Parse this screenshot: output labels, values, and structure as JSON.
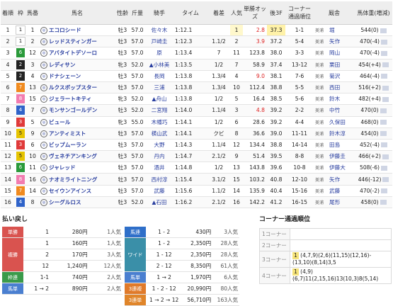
{
  "headers": [
    "着順",
    "枠",
    "馬番",
    "馬名",
    "性齢",
    "斤量",
    "騎手",
    "タイム",
    "着差",
    "人気",
    "単勝オッズ",
    "後3F",
    "コーナー通過順位",
    "厩舎",
    "馬体重(増減)"
  ],
  "rows": [
    {
      "rank": "1",
      "waku": "1",
      "num": "1",
      "name": "エコロシード",
      "sex": "牡3",
      "weight": "57.0",
      "jockey": "佐々木",
      "time": "1:12.1",
      "margin": "",
      "pop": "1",
      "odds": "2.8",
      "last3f": "37.3",
      "corner": "1-1",
      "area": "美浦",
      "trainer": "堀",
      "body": "544(0)"
    },
    {
      "rank": "2",
      "waku": "1",
      "num": "2",
      "name": "レッドスティンガー",
      "sex": "牡3",
      "weight": "57.0",
      "jockey": "戸崎圭",
      "time": "1:12.3",
      "margin": "1.1/2",
      "pop": "2",
      "odds": "3.9",
      "last3f": "37.2",
      "corner": "5-4",
      "area": "美浦",
      "trainer": "矢作",
      "body": "470(-4)"
    },
    {
      "rank": "3",
      "waku": "6",
      "num": "12",
      "name": "アバタイトデソーロ",
      "sex": "牡3",
      "weight": "57.0",
      "jockey": "原",
      "time": "1:13.4",
      "margin": "7",
      "pop": "11",
      "odds": "123.8",
      "last3f": "38.0",
      "corner": "3-3",
      "area": "美浦",
      "trainer": "岡山",
      "body": "470(-4)"
    },
    {
      "rank": "4",
      "waku": "2",
      "num": "3",
      "name": "レディサン",
      "sex": "牝3",
      "weight": "52.0",
      "jockey": "▲小林美",
      "time": "1:13.5",
      "margin": "1/2",
      "pop": "7",
      "odds": "58.9",
      "last3f": "37.4",
      "corner": "13-12",
      "area": "美浦",
      "trainer": "栗田",
      "body": "454(+4)"
    },
    {
      "rank": "5",
      "waku": "2",
      "num": "4",
      "name": "ドナシェーン",
      "sex": "牡3",
      "weight": "57.0",
      "jockey": "長岡",
      "time": "1:13.8",
      "margin": "1.3/4",
      "pop": "4",
      "odds": "9.0",
      "last3f": "38.1",
      "corner": "7-6",
      "area": "美浦",
      "trainer": "菊沢",
      "body": "464(-4)"
    },
    {
      "rank": "6",
      "waku": "7",
      "num": "13",
      "name": "ルクスボップスター",
      "sex": "牡3",
      "weight": "57.0",
      "jockey": "三浦",
      "time": "1:13.8",
      "margin": "1.3/4",
      "pop": "10",
      "odds": "112.4",
      "last3f": "38.8",
      "corner": "5-5",
      "area": "美浦",
      "trainer": "西田",
      "body": "516(+2)"
    },
    {
      "rank": "7",
      "waku": "8",
      "num": "15",
      "name": "ジェラートキティ",
      "sex": "牝3",
      "weight": "52.0",
      "jockey": "▲舟山",
      "time": "1:13.8",
      "margin": "1/2",
      "pop": "5",
      "odds": "16.4",
      "last3f": "38.5",
      "corner": "5-6",
      "area": "美浦",
      "trainer": "鈴木",
      "body": "482(+4)"
    },
    {
      "rank": "8",
      "waku": "4",
      "num": "7",
      "name": "モンサンゴールデン",
      "sex": "牡3",
      "weight": "52.0",
      "jockey": "二宮翔",
      "time": "1:14.0",
      "margin": "1.1/4",
      "pop": "3",
      "odds": "4.8",
      "last3f": "39.2",
      "corner": "2-2",
      "area": "美浦",
      "trainer": "中竹",
      "body": "470(0)"
    },
    {
      "rank": "9",
      "waku": "3",
      "num": "5",
      "name": "ビュール",
      "sex": "牝3",
      "weight": "55.0",
      "jockey": "木幡巧",
      "time": "1:14.1",
      "margin": "1/2",
      "pop": "6",
      "odds": "28.6",
      "last3f": "39.2",
      "corner": "4-4",
      "area": "美浦",
      "trainer": "久保田",
      "body": "468(0)"
    },
    {
      "rank": "10",
      "waku": "5",
      "num": "9",
      "name": "アンティミスト",
      "sex": "牡3",
      "weight": "57.0",
      "jockey": "横山武",
      "time": "1:14.1",
      "margin": "クビ",
      "pop": "8",
      "odds": "36.6",
      "last3f": "39.0",
      "corner": "11-11",
      "area": "美浦",
      "trainer": "鈴木淳",
      "body": "454(0)"
    },
    {
      "rank": "11",
      "waku": "3",
      "num": "6",
      "name": "ビップムーラン",
      "sex": "牡3",
      "weight": "57.0",
      "jockey": "大野",
      "time": "1:14.3",
      "margin": "1.1/4",
      "pop": "12",
      "odds": "134.4",
      "last3f": "38.8",
      "corner": "14-14",
      "area": "美浦",
      "trainer": "田島",
      "body": "452(-4)"
    },
    {
      "rank": "12",
      "waku": "5",
      "num": "10",
      "name": "ヴェネチアンキング",
      "sex": "牡3",
      "weight": "57.0",
      "jockey": "丹内",
      "time": "1:14.7",
      "margin": "2.1/2",
      "pop": "9",
      "odds": "51.4",
      "last3f": "39.5",
      "corner": "8-8",
      "area": "美浦",
      "trainer": "伊藤圭",
      "body": "466(+2)"
    },
    {
      "rank": "13",
      "waku": "6",
      "num": "11",
      "name": "ジャレッド",
      "sex": "牡3",
      "weight": "57.0",
      "jockey": "酒井",
      "time": "1:14.8",
      "margin": "1/2",
      "pop": "13",
      "odds": "143.8",
      "last3f": "39.6",
      "corner": "10-8",
      "area": "美浦",
      "trainer": "伊藤大",
      "body": "508(-6)"
    },
    {
      "rank": "14",
      "waku": "8",
      "num": "16",
      "name": "ナオミライトニング",
      "sex": "牡3",
      "weight": "57.0",
      "jockey": "西村淳",
      "time": "1:15.4",
      "margin": "3.1/2",
      "pop": "15",
      "odds": "103.2",
      "last3f": "40.8",
      "corner": "12-10",
      "area": "美浦",
      "trainer": "矢作",
      "body": "446(-12)"
    },
    {
      "rank": "15",
      "waku": "7",
      "num": "14",
      "name": "セイウンアインス",
      "sex": "牡3",
      "weight": "57.0",
      "jockey": "武藤",
      "time": "1:15.6",
      "margin": "1.1/2",
      "pop": "14",
      "odds": "135.9",
      "last3f": "40.4",
      "corner": "15-16",
      "area": "美浦",
      "trainer": "武藤",
      "body": "470(-2)"
    },
    {
      "rank": "16",
      "waku": "4",
      "num": "8",
      "name": "シーグルロス",
      "sex": "牡3",
      "weight": "52.0",
      "jockey": "▲石田",
      "time": "1:16.2",
      "margin": "2.1/2",
      "pop": "16",
      "odds": "142.2",
      "last3f": "41.2",
      "corner": "16-15",
      "area": "美浦",
      "trainer": "尾形",
      "body": "458(0)"
    }
  ],
  "payout": {
    "title": "払い戻し",
    "tansho": {
      "label": "単勝",
      "num": "1",
      "amount": "280円",
      "pop": "1人気"
    },
    "fukusho": {
      "label": "複勝",
      "lines": [
        {
          "num": "1",
          "amount": "160円",
          "pop": "1人気"
        },
        {
          "num": "2",
          "amount": "170円",
          "pop": "3人気"
        },
        {
          "num": "12",
          "amount": "1,240円",
          "pop": "12人気"
        }
      ]
    },
    "wakuren": {
      "label": "枠連",
      "num": "1-1",
      "amount": "740円",
      "pop": "2人気"
    },
    "umatan2": {
      "label": "馬単",
      "num": "1 → 2",
      "amount": "890円",
      "pop": "2人気"
    },
    "umaren": {
      "label": "馬連",
      "num": "1 - 2",
      "amount": "430円",
      "pop": "3人気"
    },
    "wide": {
      "label": "ワイド",
      "lines": [
        {
          "num": "1 - 12",
          "amount": "2,350円",
          "pop": "28人気"
        },
        {
          "num": "2 - 12",
          "amount": "8,350円",
          "pop": "61人気"
        }
      ]
    },
    "umatan": {
      "label": "馬単",
      "num": "1 → 2",
      "amount": "1,970円",
      "pop": "6人気"
    },
    "sanrenpuku": {
      "label": "3連複",
      "num": "1 - 2 - 12",
      "amount": "20,990円",
      "pop": "80人気"
    },
    "sanrentan": {
      "label": "3連単",
      "num": "1 → 2 → 12",
      "amount": "56,710円",
      "pop": "163人気"
    }
  },
  "corner": {
    "title": "コーナー通過順位",
    "rows": [
      {
        "label": "1コーナー",
        "value": ""
      },
      {
        "label": "2コーナー",
        "value": ""
      },
      {
        "label": "3コーナー",
        "lead": "1",
        "value": "(4,7,9)(2,6)(11,15)(12,16)-(13,10)(8,14)3,5"
      },
      {
        "label": "4コーナー",
        "lead": "1",
        "value": "(4,9)(6,7)11(2,15,16)13(10,3)8(5,14)"
      }
    ]
  }
}
